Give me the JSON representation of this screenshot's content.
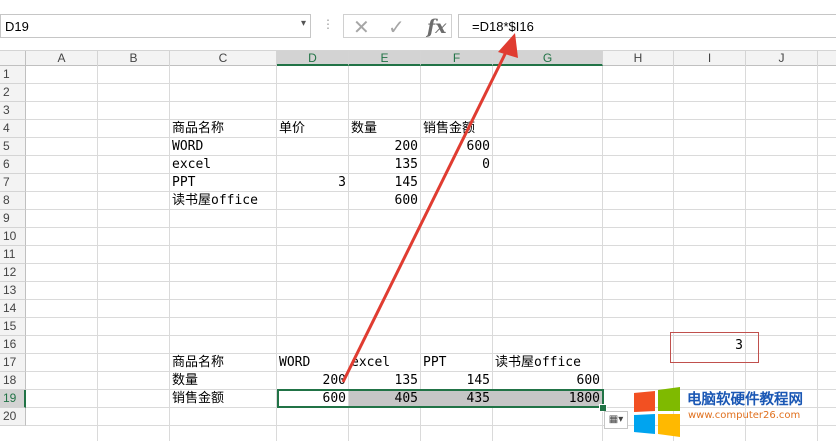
{
  "formula_bar": {
    "name_box": "D19",
    "name_box_arrow": "▾",
    "separator": "⋮",
    "cancel_icon": "✕",
    "enter_icon": "✓",
    "fx_label": "fx",
    "formula": "=D18*$I16"
  },
  "columns": [
    "A",
    "B",
    "C",
    "D",
    "E",
    "F",
    "G",
    "H",
    "I",
    "J"
  ],
  "rows": [
    "1",
    "2",
    "3",
    "4",
    "5",
    "6",
    "7",
    "8",
    "9",
    "10",
    "11",
    "12",
    "13",
    "14",
    "15",
    "16",
    "17",
    "18",
    "19",
    "20"
  ],
  "cells": {
    "C4": "商品名称",
    "D4": "单价",
    "E4": "数量",
    "F4": "销售金额",
    "C5": "WORD",
    "E5": "200",
    "F5": "600",
    "C6": "excel",
    "E6": "135",
    "F6": "0",
    "C7": "PPT",
    "D7": "3",
    "E7": "145",
    "C8": "读书屋office",
    "E8": "600",
    "I16": "3",
    "C17": "商品名称",
    "D17": "WORD",
    "E17": "excel",
    "F17": "PPT",
    "G17": "读书屋office",
    "C18": "数量",
    "D18": "200",
    "E18": "135",
    "F18": "145",
    "G18": "600",
    "C19": "销售金额",
    "D19": "600",
    "E19": "405",
    "F19": "435",
    "G19": "1800"
  },
  "paste_options_icon": "paste-options-icon",
  "watermark": {
    "title": "电脑软硬件教程网",
    "url": "www.computer26.com",
    "logo_colors": [
      "#f25022",
      "#7fba00",
      "#00a4ef",
      "#ffb900"
    ]
  },
  "colors": {
    "accent": "#217346",
    "arrow": "#e03c31",
    "highlight_box": "#c0504d"
  }
}
